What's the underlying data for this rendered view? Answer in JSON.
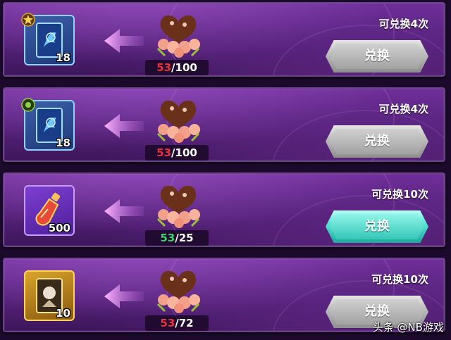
{
  "rows": [
    {
      "item": {
        "kind": "blue-card",
        "count": "18",
        "badge": "gold-star"
      },
      "have": "53",
      "need": "100",
      "have_color": "red",
      "times_label": "可兑换4次",
      "button_label": "兑换",
      "button_state": "disabled"
    },
    {
      "item": {
        "kind": "blue-card",
        "count": "18",
        "badge": "green-gear"
      },
      "have": "53",
      "need": "100",
      "have_color": "red",
      "times_label": "可兑换4次",
      "button_label": "兑换",
      "button_state": "disabled"
    },
    {
      "item": {
        "kind": "potion",
        "count": "500",
        "badge": ""
      },
      "have": "53",
      "need": "25",
      "have_color": "green",
      "times_label": "可兑换10次",
      "button_label": "兑换",
      "button_state": "active"
    },
    {
      "item": {
        "kind": "gold-card",
        "count": "10",
        "badge": ""
      },
      "have": "53",
      "need": "72",
      "have_color": "red",
      "times_label": "可兑换10次",
      "button_label": "兑换",
      "button_state": "disabled"
    }
  ],
  "watermark": "头条 @NB游戏",
  "colors": {
    "have_red": "#e8323c",
    "have_green": "#39d46a",
    "button_active": "#4fe0d0",
    "button_disabled": "#b9b9b9"
  }
}
